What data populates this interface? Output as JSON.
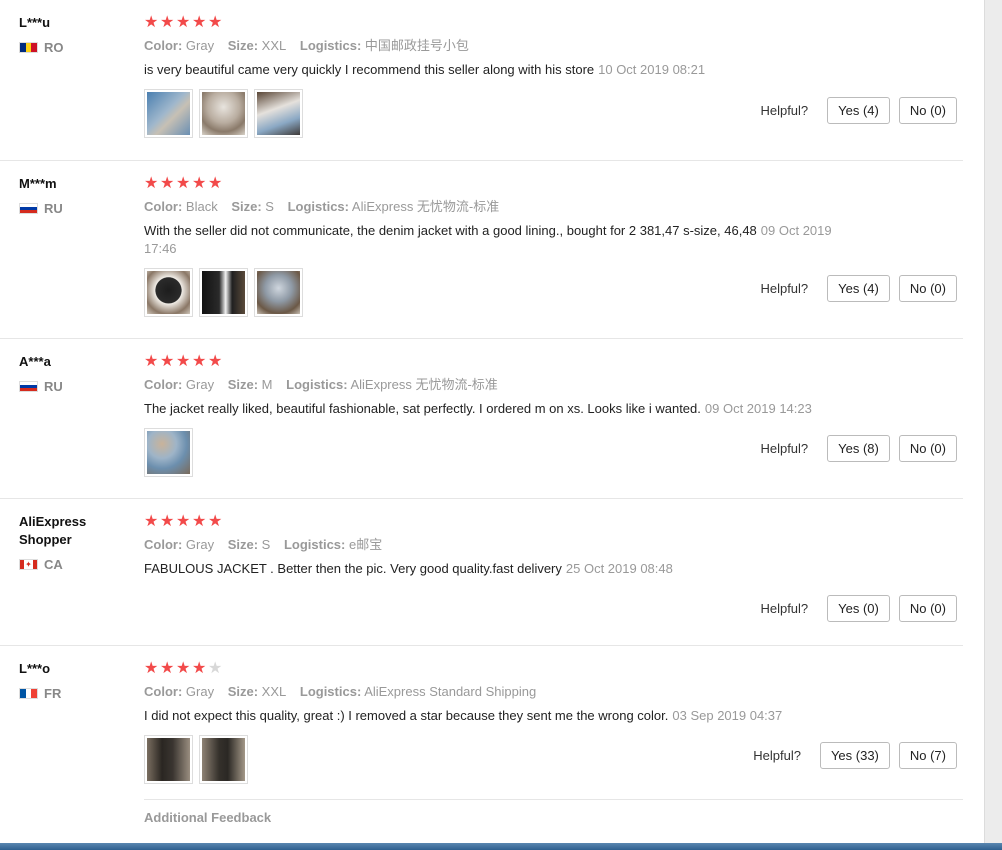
{
  "reviews": [
    {
      "user": "L***u",
      "country": "RO",
      "flag_colors": [
        "#002b7f",
        "#fcd116",
        "#ce1126"
      ],
      "rating": 5,
      "color_label": "Color:",
      "color_value": "Gray",
      "size_label": "Size:",
      "size_value": "XXL",
      "logistics_label": "Logistics:",
      "logistics_value": "中国邮政挂号小包",
      "text": "is very beautiful came very quickly I recommend this seller along with his store",
      "date": "10 Oct 2019 08:21",
      "photos": [
        "photo-jacket-1",
        "photo-jacket-2",
        "photo-jacket-3"
      ],
      "helpful_label": "Helpful?",
      "yes_label": "Yes (4)",
      "no_label": "No (0)"
    },
    {
      "user": "M***m",
      "country": "RU",
      "flag_colors": [
        "#ffffff",
        "#0039a6",
        "#d52b1e"
      ],
      "rating": 5,
      "color_label": "Color:",
      "color_value": "Black",
      "size_label": "Size:",
      "size_value": "S",
      "logistics_label": "Logistics:",
      "logistics_value": "AliExpress 无忧物流-标准",
      "text": "With the seller did not communicate, the denim jacket with a good lining., bought for 2 381,47 s-size, 46,48",
      "date": "09 Oct 2019 17:46",
      "photos": [
        "photo-jacket-1",
        "photo-jacket-2",
        "photo-jacket-3"
      ],
      "helpful_label": "Helpful?",
      "yes_label": "Yes (4)",
      "no_label": "No (0)"
    },
    {
      "user": "A***a",
      "country": "RU",
      "flag_colors": [
        "#ffffff",
        "#0039a6",
        "#d52b1e"
      ],
      "rating": 5,
      "color_label": "Color:",
      "color_value": "Gray",
      "size_label": "Size:",
      "size_value": "M",
      "logistics_label": "Logistics:",
      "logistics_value": "AliExpress 无忧物流-标准",
      "text": "The jacket really liked, beautiful fashionable, sat perfectly. I ordered m on xs. Looks like i wanted.",
      "date": "09 Oct 2019 14:23",
      "photos": [
        "photo-jacket-1"
      ],
      "helpful_label": "Helpful?",
      "yes_label": "Yes (8)",
      "no_label": "No (0)"
    },
    {
      "user": "AliExpress Shopper",
      "country": "CA",
      "flag_colors": [
        "#d52b1e",
        "#ffffff",
        "#d52b1e"
      ],
      "rating": 5,
      "color_label": "Color:",
      "color_value": "Gray",
      "size_label": "Size:",
      "size_value": "S",
      "logistics_label": "Logistics:",
      "logistics_value": "e邮宝",
      "text": "FABULOUS JACKET . Better then the pic. Very good quality.fast delivery",
      "date": "25 Oct 2019 08:48",
      "photos": [],
      "helpful_label": "Helpful?",
      "yes_label": "Yes (0)",
      "no_label": "No (0)"
    },
    {
      "user": "L***o",
      "country": "FR",
      "flag_colors": [
        "#0055a4",
        "#ffffff",
        "#ef4135"
      ],
      "rating": 4,
      "color_label": "Color:",
      "color_value": "Gray",
      "size_label": "Size:",
      "size_value": "XXL",
      "logistics_label": "Logistics:",
      "logistics_value": "AliExpress Standard Shipping",
      "text": "I did not expect this quality, great :) I removed a star because they sent me the wrong color.",
      "date": "03 Sep 2019 04:37",
      "photos": [
        "photo-jacket-1",
        "photo-jacket-2"
      ],
      "helpful_label": "Helpful?",
      "yes_label": "Yes (33)",
      "no_label": "No (7)"
    }
  ],
  "additional_feedback_label": "Additional Feedback",
  "colors": {
    "star": "#f24a4a",
    "star_off": "#d8d8d8",
    "muted": "#999999",
    "bottom_bar": "#2e5f8f"
  }
}
